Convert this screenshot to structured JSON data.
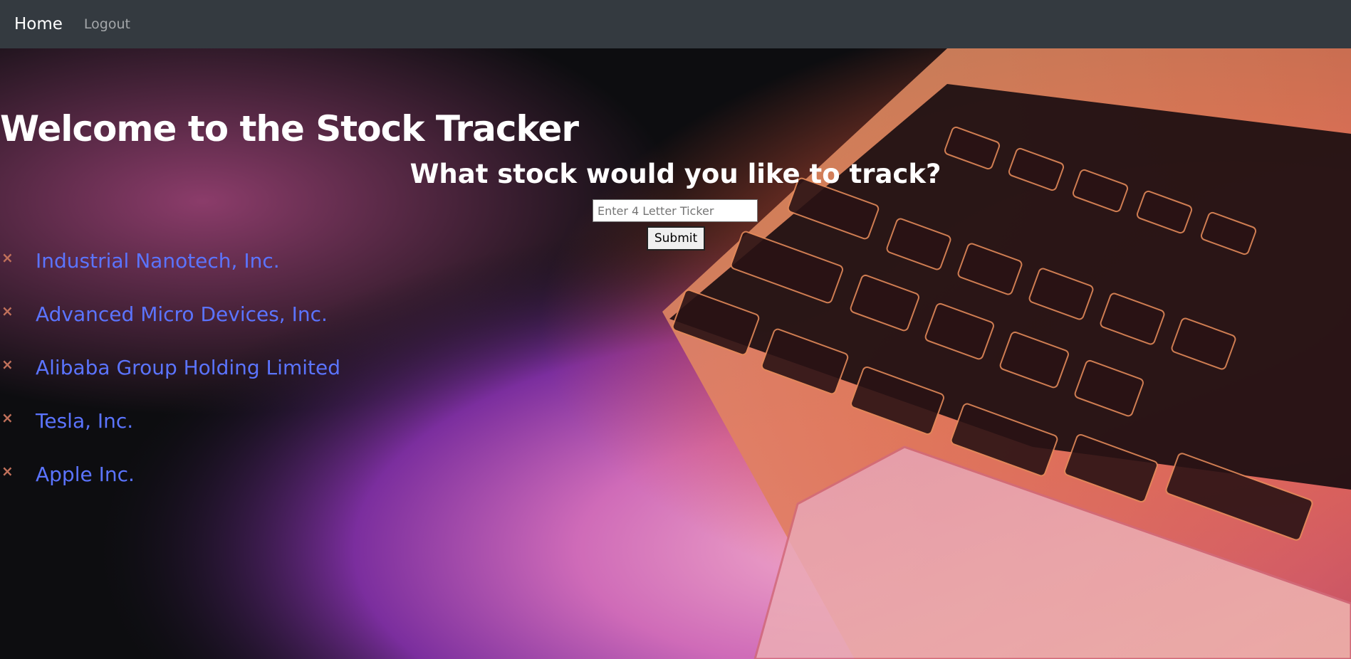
{
  "navbar": {
    "brand": "Home",
    "logout": "Logout"
  },
  "main": {
    "title": "Welcome to the Stock Tracker",
    "question": "What stock would you like to track?",
    "ticker_input": {
      "value": "",
      "placeholder": "Enter 4 Letter Ticker"
    },
    "submit_label": "Submit"
  },
  "stocks": [
    {
      "name": "Industrial Nanotech, Inc.",
      "remove_icon": "×"
    },
    {
      "name": "Advanced Micro Devices, Inc.",
      "remove_icon": "×"
    },
    {
      "name": "Alibaba Group Holding Limited",
      "remove_icon": "×"
    },
    {
      "name": "Tesla, Inc.",
      "remove_icon": "×"
    },
    {
      "name": "Apple Inc.",
      "remove_icon": "×"
    }
  ],
  "colors": {
    "navbar_bg": "#343a40",
    "link": "#5b74ff",
    "remove_icon": "#c0705a"
  }
}
